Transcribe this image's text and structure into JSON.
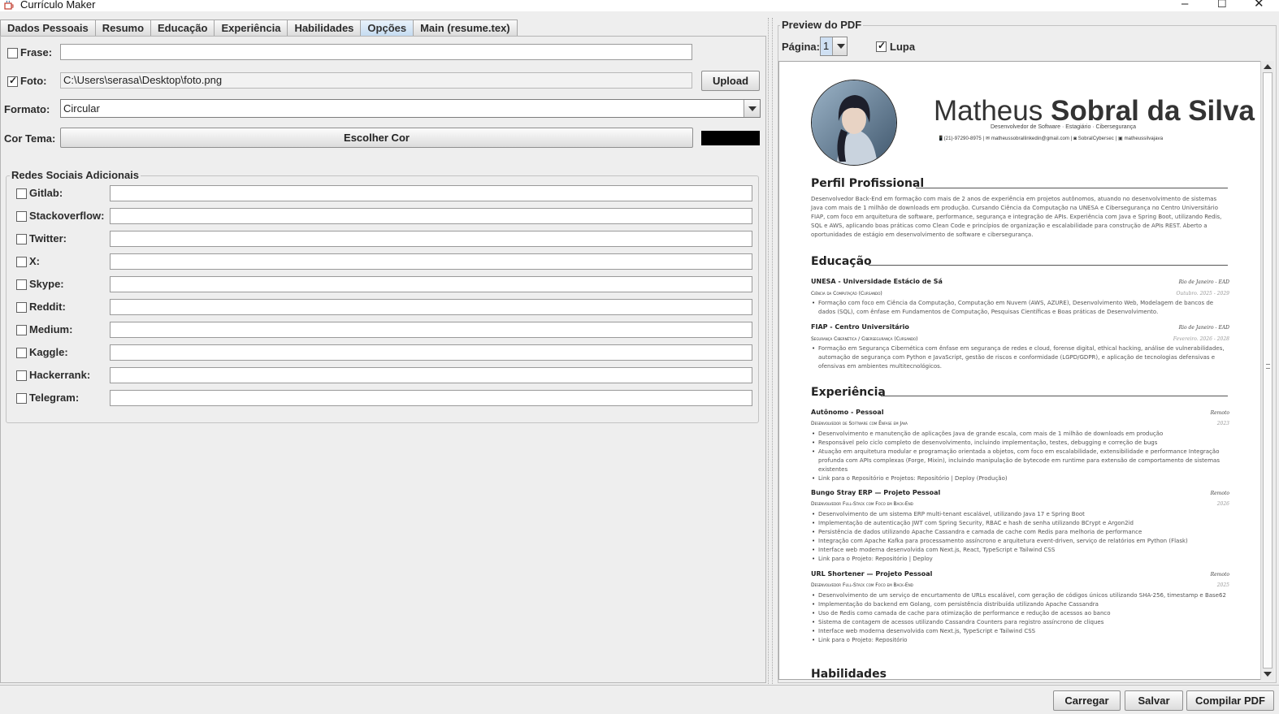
{
  "window": {
    "title": "Currículo Maker",
    "minimize": "–",
    "maximize": "☐",
    "close": "✕"
  },
  "tabs": [
    {
      "label": "Dados Pessoais"
    },
    {
      "label": "Resumo"
    },
    {
      "label": "Educação"
    },
    {
      "label": "Experiência"
    },
    {
      "label": "Habilidades"
    },
    {
      "label": "Opções",
      "active": true
    },
    {
      "label": "Main (resume.tex)"
    }
  ],
  "options": {
    "frase": {
      "label": "Frase:",
      "checked": false,
      "value": ""
    },
    "foto": {
      "label": "Foto:",
      "checked": true,
      "value": "C:\\Users\\serasa\\Desktop\\foto.png",
      "button": "Upload"
    },
    "formato": {
      "label": "Formato:",
      "value": "Circular"
    },
    "cor_tema": {
      "label": "Cor Tema:",
      "button": "Escolher Cor",
      "swatch": "#000000"
    }
  },
  "social": {
    "title": "Redes Sociais Adicionais",
    "items": [
      {
        "label": "Gitlab:"
      },
      {
        "label": "Stackoverflow:"
      },
      {
        "label": "Twitter:"
      },
      {
        "label": "X:"
      },
      {
        "label": "Skype:"
      },
      {
        "label": "Reddit:"
      },
      {
        "label": "Medium:"
      },
      {
        "label": "Kaggle:"
      },
      {
        "label": "Hackerrank:"
      },
      {
        "label": "Telegram:"
      }
    ]
  },
  "preview": {
    "title": "Preview do PDF",
    "page_label": "Página:",
    "page_value": "1",
    "lupa_label": "Lupa",
    "lupa_checked": true
  },
  "resume": {
    "first_name": "Matheus",
    "last_name": "Sobral da Silva",
    "subtitle": "Desenvolvedor de Software · Estagiário · Cibersegurança",
    "contact": "📱(21)-97290-8975   |   ✉ matheussobrallinkedin@gmail.com   |   ◙ SobralCybersec   |   ▣ matheussilvajava",
    "sections": {
      "perfil": "Perfil Profissional",
      "educacao": "Educação",
      "experiencia": "Experiência",
      "habilidades": "Habilidades"
    },
    "perfil_text": "Desenvolvedor Back-End em formação com mais de 2 anos de experiência em projetos autônomos, atuando no desenvolvimento de sistemas Java com mais de 1 milhão de downloads em produção. Cursando Ciência da Computação na UNESA e Cibersegurança no Centro Universitário FIAP, com foco em arquitetura de software, performance, segurança e integração de APIs. Experiência com Java e Spring Boot, utilizando Redis, SQL e AWS, aplicando boas práticas como Clean Code e princípios de organização e escalabilidade para construção de APIs REST. Aberto a oportunidades de estágio em desenvolvimento de software e cibersegurança.",
    "edu": [
      {
        "school": "UNESA - Universidade Estácio de Sá",
        "place": "Rio de Janeiro - EAD",
        "course": "Ciência da Computação (Cursando)",
        "period": "Outubro. 2025 - 2029",
        "bullet": "Formação com foco em Ciência da Computação, Computação em Nuvem (AWS, AZURE), Desenvolvimento Web, Modelagem de bancos de dados (SQL), com ênfase em Fundamentos de Computação, Pesquisas Científicas e Boas práticas de Desenvolvimento."
      },
      {
        "school": "FIAP - Centro Universitário",
        "place": "Rio de Janeiro - EAD",
        "course": "Segurança Cibernética / Cibersegurança (Cursando)",
        "period": "Fevereiro. 2026 - 2028",
        "bullet": "Formação em Segurança Cibernética com ênfase em segurança de redes e cloud, forense digital, ethical hacking, análise de vulnerabilidades, automação de segurança com Python e JavaScript, gestão de riscos e conformidade (LGPD/GDPR), e aplicação de tecnologias defensivas e ofensivas em ambientes multitecnológicos."
      }
    ],
    "exp": [
      {
        "title": "Autônomo - Pessoal",
        "place": "Remoto",
        "role": "Desenvolvedor de Software com Ênfase em Java",
        "year": "2023",
        "bullets": [
          "Desenvolvimento e manutenção de aplicações Java de grande escala, com mais de 1 milhão de downloads em produção",
          "Responsável pelo ciclo completo de desenvolvimento, incluindo implementação, testes, debugging e correção de bugs",
          "Atuação em arquitetura modular e programação orientada a objetos, com foco em escalabilidade, extensibilidade e performance Integração profunda com APIs complexas (Forge, Mixin), incluindo manipulação de bytecode em runtime para extensão de comportamento de sistemas existentes",
          "Link para o Repositório e Projetos: Repositório | Deploy (Produção)"
        ]
      },
      {
        "title": "Bungo Stray ERP — Projeto Pessoal",
        "place": "Remoto",
        "role": "Desenvolvedor Full-Stack com Foco em Back-End",
        "year": "2026",
        "bullets": [
          "Desenvolvimento de um sistema ERP multi-tenant escalável, utilizando Java 17 e Spring Boot",
          "Implementação de autenticação JWT com Spring Security, RBAC e hash de senha utilizando BCrypt e Argon2id",
          "Persistência de dados utilizando Apache Cassandra e camada de cache com Redis para melhoria de performance",
          "Integração com Apache Kafka para processamento assíncrono e arquitetura event-driven, serviço de relatórios em Python (Flask)",
          "Interface web moderna desenvolvida com Next.js, React, TypeScript e Tailwind CSS",
          "Link para o Projeto: Repositório | Deploy"
        ]
      },
      {
        "title": "URL Shortener — Projeto Pessoal",
        "place": "Remoto",
        "role": "Desenvolvedor Full-Stack com Foco em Back-End",
        "year": "2025",
        "bullets": [
          "Desenvolvimento de um serviço de encurtamento de URLs escalável, com geração de códigos únicos utilizando SHA-256, timestamp e Base62",
          "Implementação do backend em Golang, com persistência distribuída utilizando Apache Cassandra",
          "Uso de Redis como camada de cache para otimização de performance e redução de acessos ao banco",
          "Sistema de contagem de acessos utilizando Cassandra Counters para registro assíncrono de cliques",
          "Interface web moderna desenvolvida com Next.js, TypeScript e Tailwind CSS",
          "Link para o Projeto: Repositório"
        ]
      }
    ]
  },
  "footer": {
    "carregar": "Carregar",
    "salvar": "Salvar",
    "compilar": "Compilar PDF"
  }
}
